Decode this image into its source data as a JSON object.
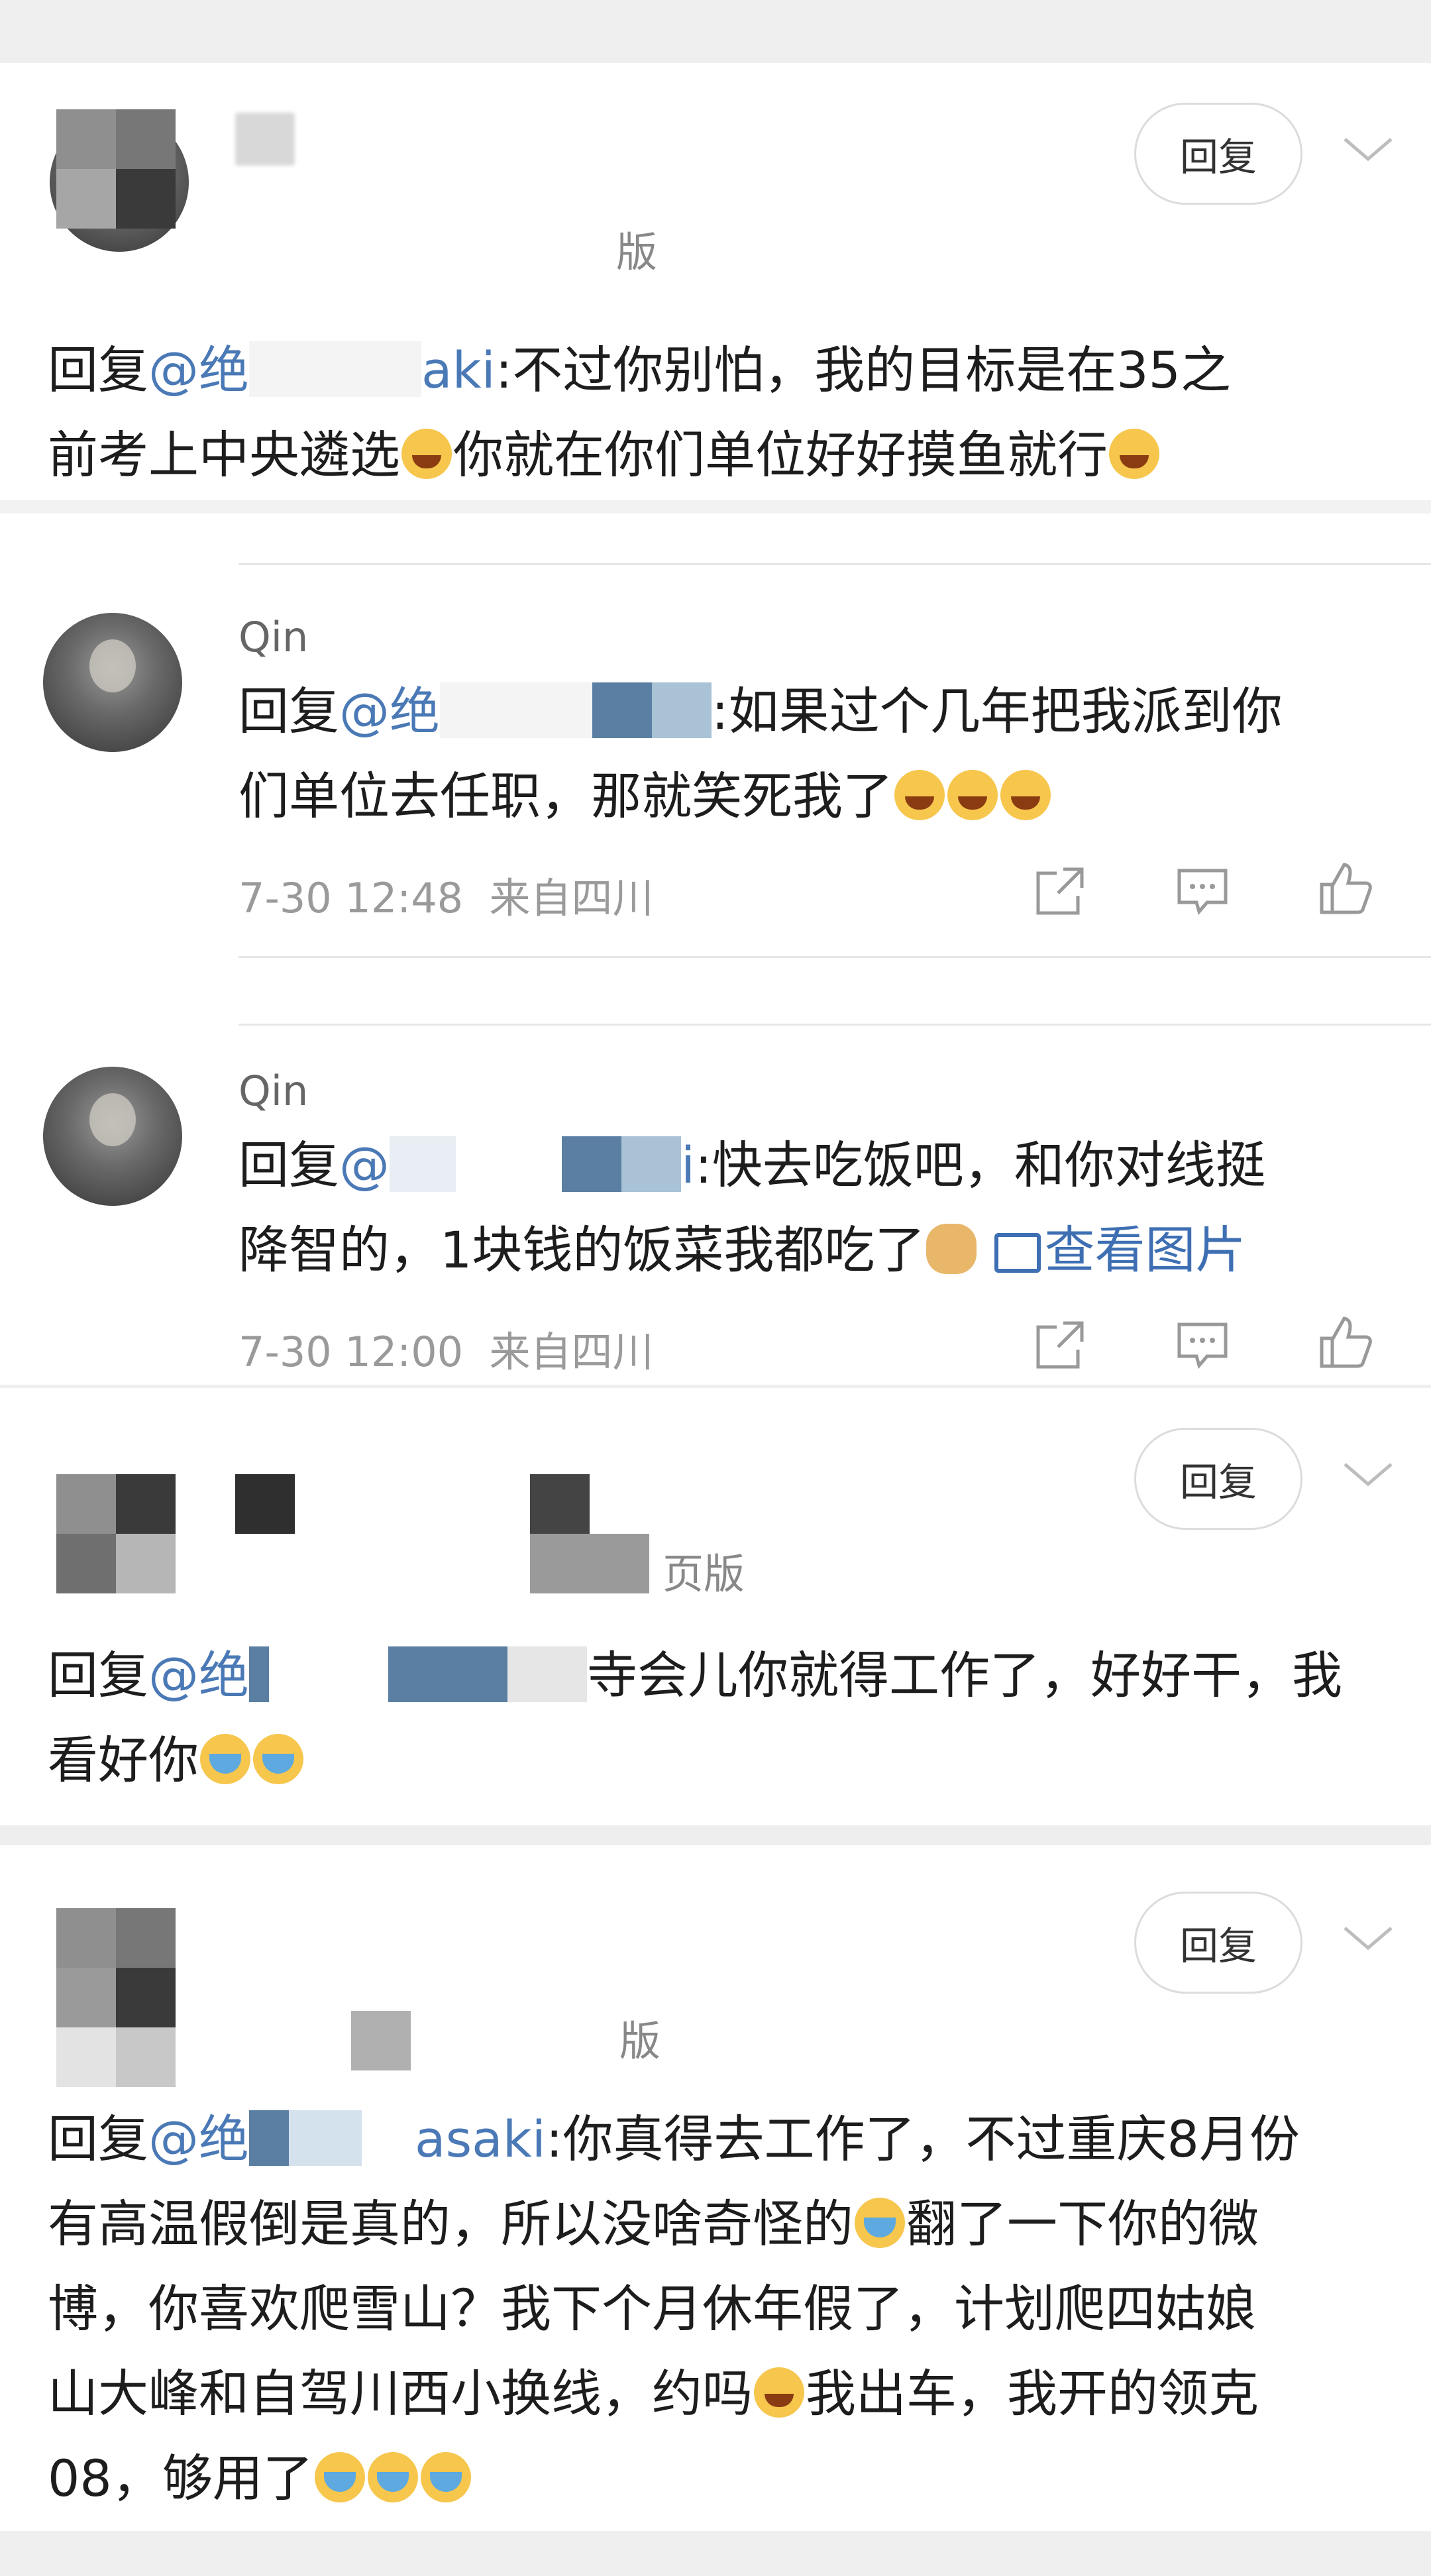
{
  "comments": [
    {
      "reply_label": "回复",
      "text_prefix": "回复",
      "mention": "@绝",
      "mention_tail": "aki",
      "line1": ":不过你别怕，我的目标是在35之",
      "line2a": "前考上中央遴选",
      "line2b": "你就在你们单位好好摸鱼就行",
      "badge_fragment": "版"
    },
    {
      "name": "Qin",
      "text_prefix": "回复",
      "mention": "@绝",
      "line1": ":如果过个几年把我派到你",
      "line2": "们单位去任职，那就笑死我了",
      "time": "7-30 12:48",
      "location": "来自四川"
    },
    {
      "name": "Qin",
      "text_prefix": "回复",
      "mention": "@",
      "mention_tail": "i",
      "line1": ":快去吃饭吧，和你对线挺",
      "line2": "降智的，1块钱的饭菜我都吃了",
      "view_image": "查看图片",
      "time": "7-30 12:00",
      "location": "来自四川"
    },
    {
      "reply_label": "回复",
      "text_prefix": "回复",
      "mention": "@绝",
      "line1": "寺会儿你就得工作了，好好干，我",
      "line2": "看好你",
      "badge_fragment": "页版"
    },
    {
      "reply_label": "回复",
      "text_prefix": "回复",
      "mention": "@绝",
      "mention_tail": "asaki",
      "line1": ":你真得去工作了，不过重庆8月份",
      "line2": "有高温假倒是真的，所以没啥奇怪的",
      "line2b": "翻了一下你的微",
      "line3": "博，你喜欢爬雪山？我下个月休年假了，计划爬四姑娘",
      "line4": "山大峰和自驾川西小换线，约吗",
      "line4b": "我出车，我开的领克",
      "line5": "08，够用了",
      "badge_fragment": "版"
    }
  ],
  "icons": [
    "share-icon",
    "comment-icon",
    "like-icon",
    "chevron-down-icon"
  ],
  "colors": {
    "mention": "#4a79b6",
    "link": "#3e6fb3",
    "meta": "#9a9a9a"
  }
}
